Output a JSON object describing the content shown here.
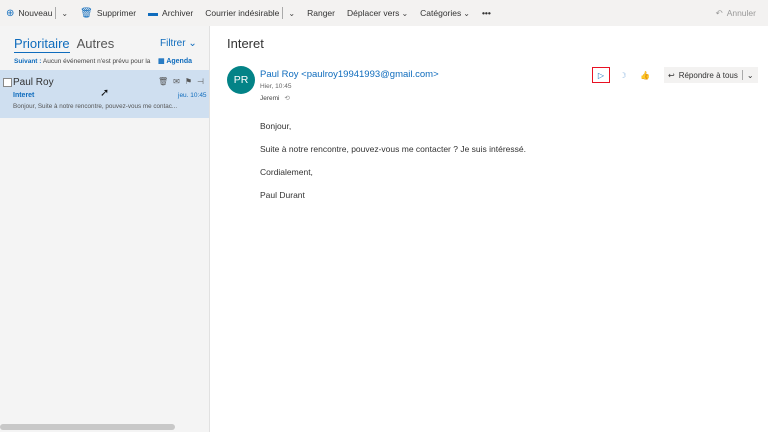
{
  "toolbar": {
    "new": "Nouveau",
    "delete": "Supprimer",
    "archive": "Archiver",
    "junk": "Courrier indésirable",
    "sweep": "Ranger",
    "move": "Déplacer vers",
    "categories": "Catégories",
    "more": "•••",
    "undo": "Annuler"
  },
  "list": {
    "tab_focused": "Prioritaire",
    "tab_other": "Autres",
    "filter": "Filtrer",
    "next_label": "Suivant :",
    "next_text": "Aucun événement n'est prévu pour la",
    "agenda": "Agenda",
    "messages": [
      {
        "sender": "Paul Roy",
        "subject": "Interet",
        "date": "jeu. 10:45",
        "preview": "Bonjour,  Suite à notre rencontre, pouvez-vous me contac..."
      }
    ]
  },
  "reading": {
    "subject": "Interet",
    "avatar_initials": "PR",
    "avatar_color": "#038387",
    "from": "Paul Roy <paulroy19941993@gmail.com>",
    "date": "Hier, 10:45",
    "to": "Jeremi",
    "reply_all": "Répondre à tous",
    "body": [
      "Bonjour,",
      "Suite à notre rencontre, pouvez-vous me contacter ? Je suis intéressé.",
      "Cordialement,",
      "Paul Durant"
    ]
  },
  "colors": {
    "accent": "#0f6cbd",
    "selected_item": "#cfdff0"
  }
}
